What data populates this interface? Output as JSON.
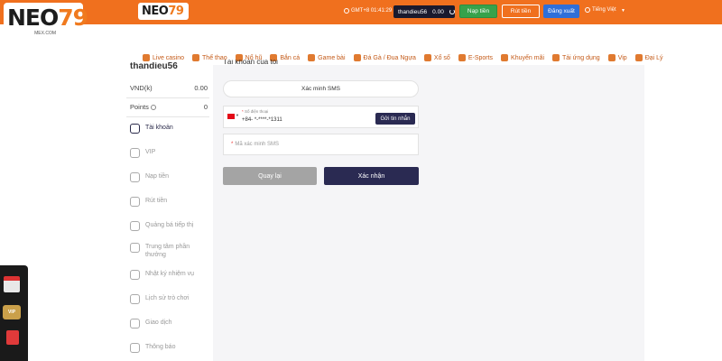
{
  "brand": {
    "logo_text": "NEO",
    "logo_number": "79",
    "logo_sub": "MEX.COM",
    "small_logo_text": "NEO",
    "small_logo_number": "79"
  },
  "header": {
    "clock": "GMT+8 01:41:29",
    "username": "thandieu56",
    "balance": "0.00",
    "deposit_label": "Nạp tiền",
    "withdraw_label": "Rút tiền",
    "logout_label": "Đăng xuất",
    "language": "Tiếng Việt"
  },
  "nav": [
    {
      "label": "Live casino",
      "icon": "dice-icon"
    },
    {
      "label": "Thể thao",
      "icon": "ball-icon"
    },
    {
      "label": "Nổ hũ",
      "icon": "slot-icon"
    },
    {
      "label": "Bắn cá",
      "icon": "fish-icon"
    },
    {
      "label": "Game bài",
      "icon": "cards-icon"
    },
    {
      "label": "Đá Gà / Đua Ngựa",
      "icon": "rooster-icon"
    },
    {
      "label": "Xổ số",
      "icon": "lottery-icon"
    },
    {
      "label": "E-Sports",
      "icon": "gamepad-icon"
    },
    {
      "label": "Khuyến mãi",
      "icon": "gift-icon"
    },
    {
      "label": "Tải ứng dụng",
      "icon": "phone-icon"
    },
    {
      "label": "Vip",
      "icon": "rocket-icon"
    },
    {
      "label": "Đại Lý",
      "icon": "agent-icon"
    }
  ],
  "sidebar": {
    "username": "thandieu56",
    "currency_label": "VND(k)",
    "currency_value": "0.00",
    "points_label": "Points",
    "points_value": "0",
    "items": [
      {
        "label": "Tài khoản",
        "icon": "user-shield-icon",
        "active": true
      },
      {
        "label": "VIP",
        "icon": "vip-icon",
        "active": false
      },
      {
        "label": "Nạp tiền",
        "icon": "deposit-icon",
        "active": false
      },
      {
        "label": "Rút tiền",
        "icon": "withdraw-icon",
        "active": false
      },
      {
        "label": "Quảng bá tiếp thị",
        "icon": "megaphone-icon",
        "active": false
      },
      {
        "label": "Trung tâm phần thưởng",
        "icon": "gift-box-icon",
        "active": false
      },
      {
        "label": "Nhật ký nhiệm vụ",
        "icon": "task-icon",
        "active": false
      },
      {
        "label": "Lịch sử trò chơi",
        "icon": "history-icon",
        "active": false
      },
      {
        "label": "Giao dịch",
        "icon": "transaction-icon",
        "active": false
      },
      {
        "label": "Thông báo",
        "icon": "mail-icon",
        "active": false
      }
    ]
  },
  "main": {
    "section_title": "Tài khoản của tôi",
    "sms_label": "Xác minh SMS",
    "phone_label": "Số điện thoại",
    "phone_value": "+84- *-****-*1311",
    "send_code_label": "Gởi tin nhắn",
    "code_placeholder": "Mã xác minh SMS",
    "back_label": "Quay lại",
    "confirm_label": "Xác nhận"
  },
  "dock": {
    "vip_label": "VIP"
  },
  "colors": {
    "brand_orange": "#f0701e",
    "navy": "#2a2a52",
    "deposit_green": "#37a24b",
    "logout_blue": "#2f6fd8"
  }
}
